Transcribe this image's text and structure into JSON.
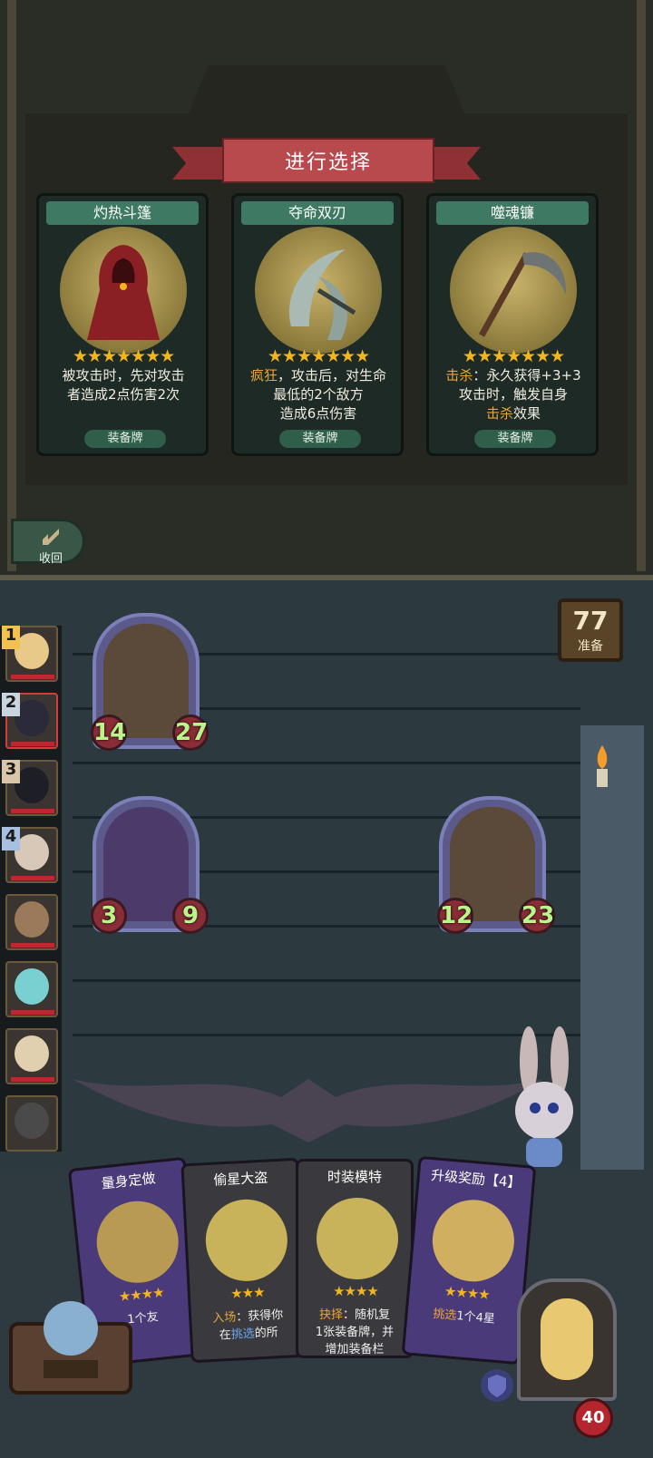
{
  "selection": {
    "title": "进行选择",
    "collapse_label": "收回",
    "cards": [
      {
        "name": "灼热斗篷",
        "stars": 7,
        "desc_lines": [
          [
            "被攻击时，先对攻击"
          ],
          [
            "者造成2点伤害2次"
          ]
        ],
        "foot": "装备牌"
      },
      {
        "name": "夺命双刃",
        "stars": 7,
        "desc_line1_hl": "疯狂",
        "desc_line1_rest": "，攻击后，对生命",
        "desc_line2": "最低的2个敌方",
        "desc_line3": "造成6点伤害",
        "foot": "装备牌"
      },
      {
        "name": "噬魂镰",
        "stars": 7,
        "desc_line1_hl": "击杀",
        "desc_line1_rest": "：永久获得+3+3",
        "desc_line2": "攻击时，触发自身",
        "desc_line3_hl": "击杀",
        "desc_line3_rest": "效果",
        "foot": "装备牌"
      }
    ],
    "card1_line1": "被攻击时，先对攻击",
    "card1_line2": "者造成2点伤害2次"
  },
  "battle": {
    "ready_count": "77",
    "ready_label": "准备",
    "enemies": [
      {
        "atk": "14",
        "hp": "27"
      },
      {
        "atk": "3",
        "hp": "9"
      },
      {
        "atk": "12",
        "hp": "23"
      }
    ],
    "turn_numbers": [
      "1",
      "2",
      "3",
      "4"
    ]
  },
  "hand": {
    "cards": [
      {
        "title": "量身定做",
        "desc": "1个友"
      },
      {
        "title": "偷星大盗",
        "desc_hl": "入场",
        "desc_rest": "：获得你",
        "desc2_pre": "在",
        "desc2_hl": "挑选",
        "desc2_rest": "的所"
      },
      {
        "title": "时装模特",
        "desc_hl": "抉择",
        "desc_rest": "：随机复",
        "desc2": "1张装备牌，并",
        "desc3": "增加装备栏"
      },
      {
        "title": "升级奖励【4】",
        "desc_hl": "挑选",
        "desc_rest": "1个4星"
      }
    ],
    "hero_hp": "40"
  },
  "colors": {
    "accent_red": "#b84a4d",
    "card_green": "#3e7a63",
    "stat_green": "#b9f58a",
    "highlight": "#e8a53a"
  }
}
